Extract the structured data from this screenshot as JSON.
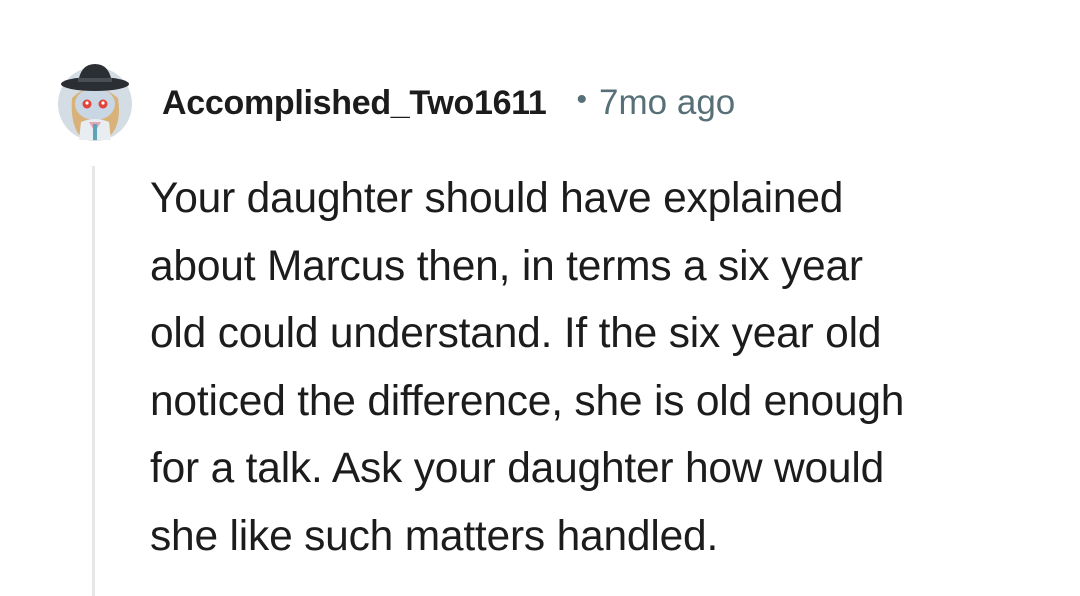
{
  "comment": {
    "author": "Accomplished_Two1611",
    "separator": "•",
    "time_ago": "7mo ago",
    "avatar_icon": "snoo-avatar-icon",
    "body_lines": [
      "Your daughter should have explained",
      "about Marcus then, in terms a six year",
      "old could understand. If the six year old",
      "noticed the difference, she is old enough",
      "for a talk. Ask your daughter how would",
      "she like such matters handled."
    ]
  },
  "colors": {
    "text_primary": "#1c1c1c",
    "text_secondary": "#576f76",
    "thread_line": "#e5e7e8"
  }
}
